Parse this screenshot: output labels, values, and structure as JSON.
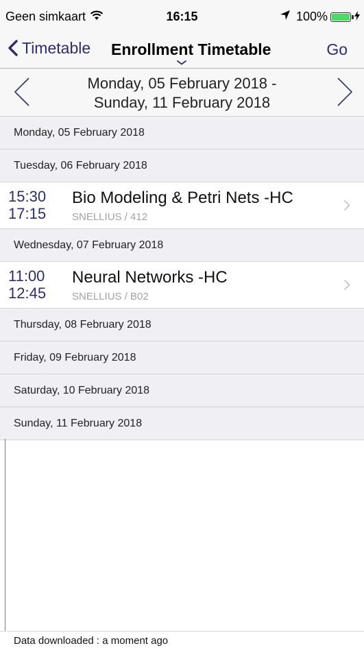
{
  "status_bar": {
    "carrier": "Geen simkaart",
    "time": "16:15",
    "battery": "100%",
    "battery_level": 1.0,
    "icons": [
      "wifi-icon",
      "location-arrow-icon",
      "battery-icon",
      "charging-bolt-icon"
    ]
  },
  "nav": {
    "back_label": "Timetable",
    "title": "Enrollment Timetable",
    "action_label": "Go"
  },
  "week": {
    "range_line1": "Monday, 05 February 2018 -",
    "range_line2": "Sunday, 11 February 2018"
  },
  "days": [
    {
      "label": "Monday, 05 February 2018",
      "events": []
    },
    {
      "label": "Tuesday, 06 February 2018",
      "events": [
        {
          "start": "15:30",
          "end": "17:15",
          "title": "Bio Modeling & Petri Nets -HC",
          "location": "SNELLIUS / 412"
        }
      ]
    },
    {
      "label": "Wednesday, 07 February 2018",
      "events": [
        {
          "start": "11:00",
          "end": "12:45",
          "title": "Neural Networks -HC",
          "location": "SNELLIUS / B02"
        }
      ]
    },
    {
      "label": "Thursday, 08 February 2018",
      "events": []
    },
    {
      "label": "Friday, 09 February 2018",
      "events": []
    },
    {
      "label": "Saturday, 10 February 2018",
      "events": []
    },
    {
      "label": "Sunday, 11 February 2018",
      "events": []
    }
  ],
  "footer": {
    "text": "Data downloaded : a moment ago"
  },
  "colors": {
    "accent": "#2c2d6a",
    "section_bg": "#efeff4",
    "secondary_text": "#a2a2a7",
    "battery": "#4cd964"
  }
}
